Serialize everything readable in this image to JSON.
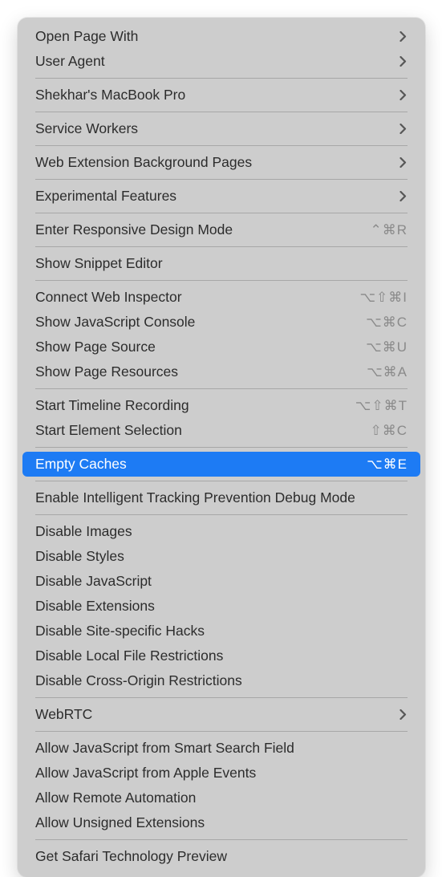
{
  "menu": {
    "groups": [
      [
        {
          "id": "open-page-with",
          "label": "Open Page With",
          "submenu": true
        },
        {
          "id": "user-agent",
          "label": "User Agent",
          "submenu": true
        }
      ],
      [
        {
          "id": "device-name",
          "label": "Shekhar's MacBook Pro",
          "submenu": true
        }
      ],
      [
        {
          "id": "service-workers",
          "label": "Service Workers",
          "submenu": true
        }
      ],
      [
        {
          "id": "web-extension-bg",
          "label": "Web Extension Background Pages",
          "submenu": true
        }
      ],
      [
        {
          "id": "experimental-features",
          "label": "Experimental Features",
          "submenu": true
        }
      ],
      [
        {
          "id": "responsive-design-mode",
          "label": "Enter Responsive Design Mode",
          "shortcut": "⌃⌘R"
        }
      ],
      [
        {
          "id": "snippet-editor",
          "label": "Show Snippet Editor"
        }
      ],
      [
        {
          "id": "connect-web-inspector",
          "label": "Connect Web Inspector",
          "shortcut": "⌥⇧⌘I"
        },
        {
          "id": "js-console",
          "label": "Show JavaScript Console",
          "shortcut": "⌥⌘C"
        },
        {
          "id": "page-source",
          "label": "Show Page Source",
          "shortcut": "⌥⌘U"
        },
        {
          "id": "page-resources",
          "label": "Show Page Resources",
          "shortcut": "⌥⌘A"
        }
      ],
      [
        {
          "id": "timeline-recording",
          "label": "Start Timeline Recording",
          "shortcut": "⌥⇧⌘T"
        },
        {
          "id": "element-selection",
          "label": "Start Element Selection",
          "shortcut": "⇧⌘C"
        }
      ],
      [
        {
          "id": "empty-caches",
          "label": "Empty Caches",
          "shortcut": "⌥⌘E",
          "highlighted": true
        }
      ],
      [
        {
          "id": "itp-debug",
          "label": "Enable Intelligent Tracking Prevention Debug Mode"
        }
      ],
      [
        {
          "id": "disable-images",
          "label": "Disable Images"
        },
        {
          "id": "disable-styles",
          "label": "Disable Styles"
        },
        {
          "id": "disable-js",
          "label": "Disable JavaScript"
        },
        {
          "id": "disable-extensions",
          "label": "Disable Extensions"
        },
        {
          "id": "disable-site-hacks",
          "label": "Disable Site-specific Hacks"
        },
        {
          "id": "disable-local-file",
          "label": "Disable Local File Restrictions"
        },
        {
          "id": "disable-cors",
          "label": "Disable Cross-Origin Restrictions"
        }
      ],
      [
        {
          "id": "webrtc",
          "label": "WebRTC",
          "submenu": true
        }
      ],
      [
        {
          "id": "allow-js-search",
          "label": "Allow JavaScript from Smart Search Field"
        },
        {
          "id": "allow-js-apple-events",
          "label": "Allow JavaScript from Apple Events"
        },
        {
          "id": "allow-remote-automation",
          "label": "Allow Remote Automation"
        },
        {
          "id": "allow-unsigned-ext",
          "label": "Allow Unsigned Extensions"
        }
      ],
      [
        {
          "id": "safari-tech-preview",
          "label": "Get Safari Technology Preview"
        }
      ]
    ]
  }
}
